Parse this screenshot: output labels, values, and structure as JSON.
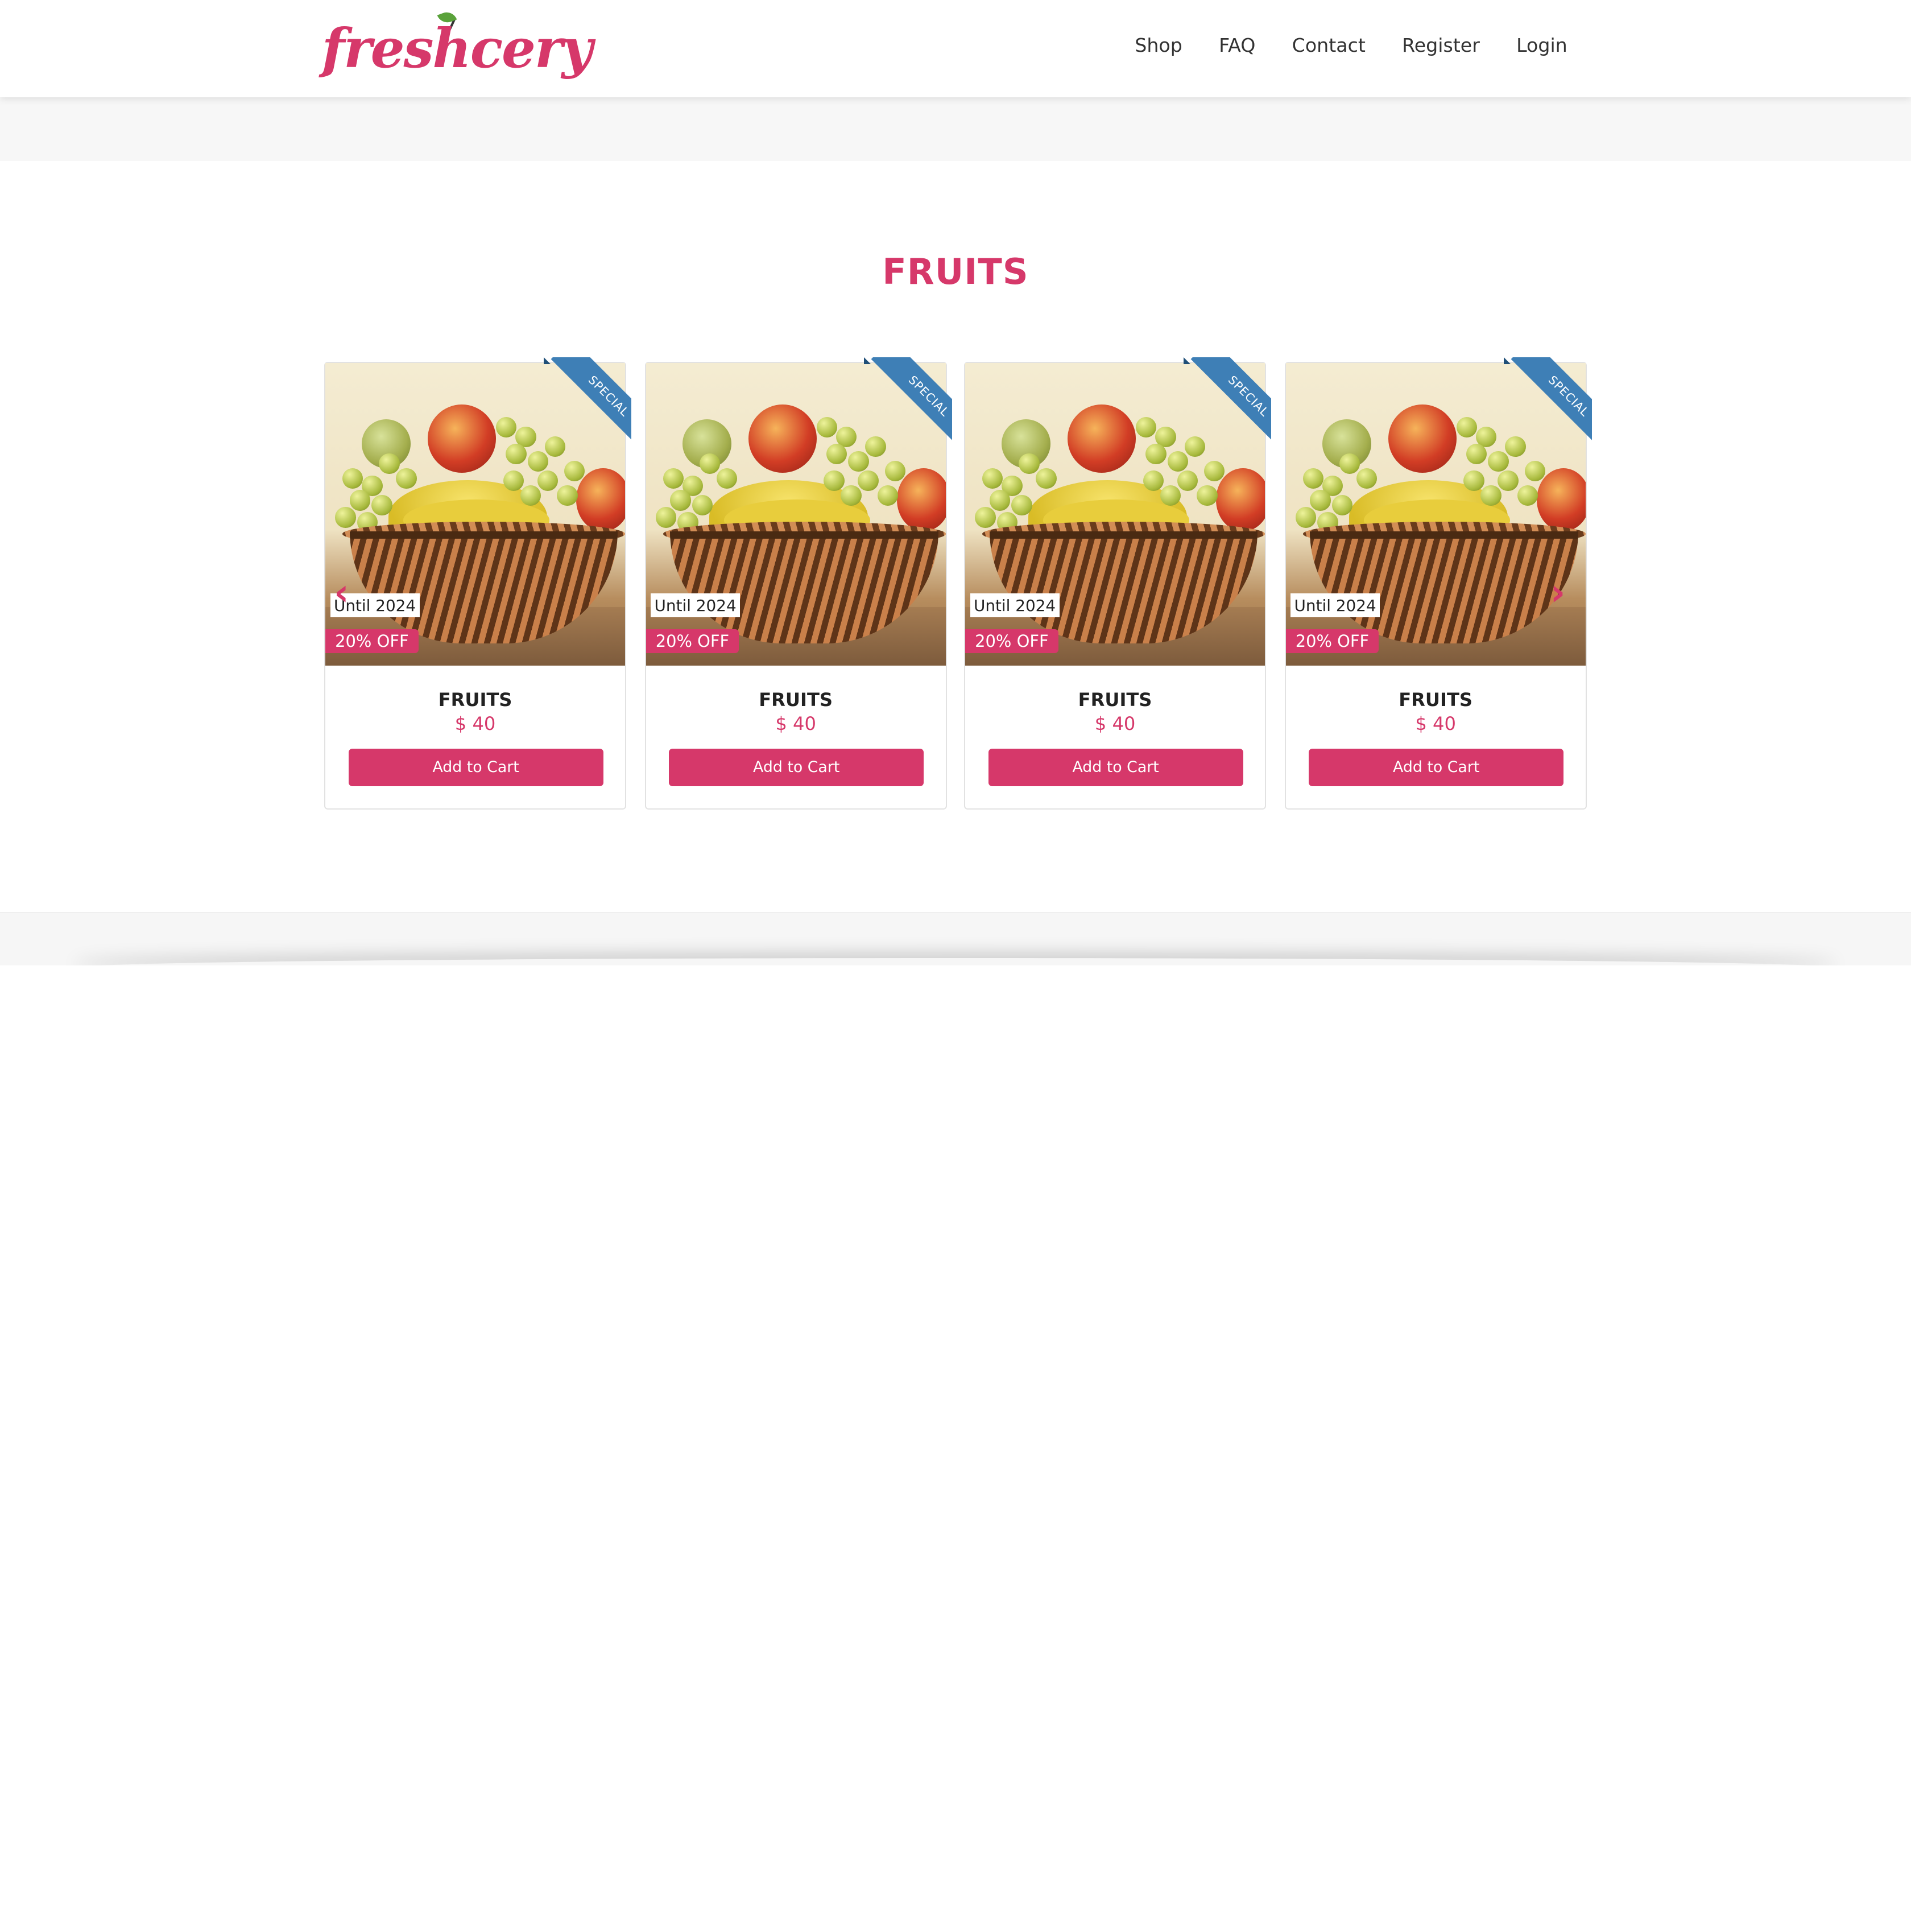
{
  "brand": {
    "logo_text": "freshcery",
    "colors": {
      "accent": "#d6386a",
      "ribbon": "#3e7fb6"
    }
  },
  "nav": {
    "items": [
      "Shop",
      "FAQ",
      "Contact",
      "Register",
      "Login"
    ]
  },
  "section": {
    "title": "FRUITS"
  },
  "carousel": {
    "prev_icon": "chevron-left-icon",
    "next_icon": "chevron-right-icon",
    "cards": [
      {
        "ribbon": "SPECIAL",
        "until": "Until 2024",
        "discount": "20% OFF",
        "name": "FRUITS",
        "price": "$ 40",
        "button": "Add to Cart"
      },
      {
        "ribbon": "SPECIAL",
        "until": "Until 2024",
        "discount": "20% OFF",
        "name": "FRUITS",
        "price": "$ 40",
        "button": "Add to Cart"
      },
      {
        "ribbon": "SPECIAL",
        "until": "Until 2024",
        "discount": "20% OFF",
        "name": "FRUITS",
        "price": "$ 40",
        "button": "Add to Cart"
      },
      {
        "ribbon": "SPECIAL",
        "until": "Until 2024",
        "discount": "20% OFF",
        "name": "FRUITS",
        "price": "$ 40",
        "button": "Add to Cart"
      }
    ]
  }
}
